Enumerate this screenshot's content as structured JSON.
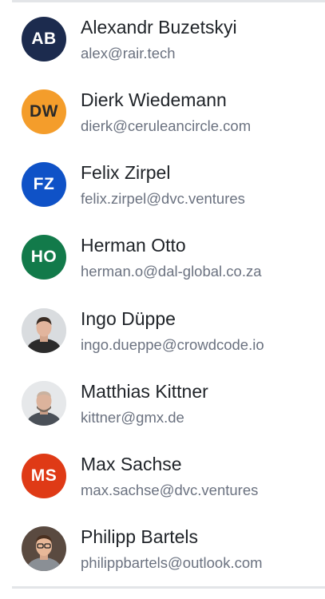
{
  "contacts": [
    {
      "name": "Alexandr Buzetskyi",
      "email": "alex@rair.tech",
      "initials": "AB",
      "avatar_color": "#1c2b4e",
      "avatar_text_color": "#ffffff"
    },
    {
      "name": "Dierk Wiedemann",
      "email": "dierk@ceruleancircle.com",
      "initials": "DW",
      "avatar_color": "#f49d2b",
      "avatar_text_color": "#2a2a2a"
    },
    {
      "name": "Felix Zirpel",
      "email": "felix.zirpel@dvc.ventures",
      "initials": "FZ",
      "avatar_color": "#0f52c7",
      "avatar_text_color": "#ffffff"
    },
    {
      "name": "Herman Otto",
      "email": "herman.o@dal-global.co.za",
      "initials": "HO",
      "avatar_color": "#127a4a",
      "avatar_text_color": "#ffffff"
    },
    {
      "name": "Ingo Düppe",
      "email": "ingo.dueppe@crowdcode.io",
      "avatar_icon": "user-photo-icon"
    },
    {
      "name": "Matthias Kittner",
      "email": "kittner@gmx.de",
      "avatar_icon": "user-photo-icon"
    },
    {
      "name": "Max Sachse",
      "email": "max.sachse@dvc.ventures",
      "initials": "MS",
      "avatar_color": "#df3a16",
      "avatar_text_color": "#ffffff"
    },
    {
      "name": "Philipp Bartels",
      "email": "philippbartels@outlook.com",
      "avatar_icon": "user-photo-icon"
    }
  ]
}
